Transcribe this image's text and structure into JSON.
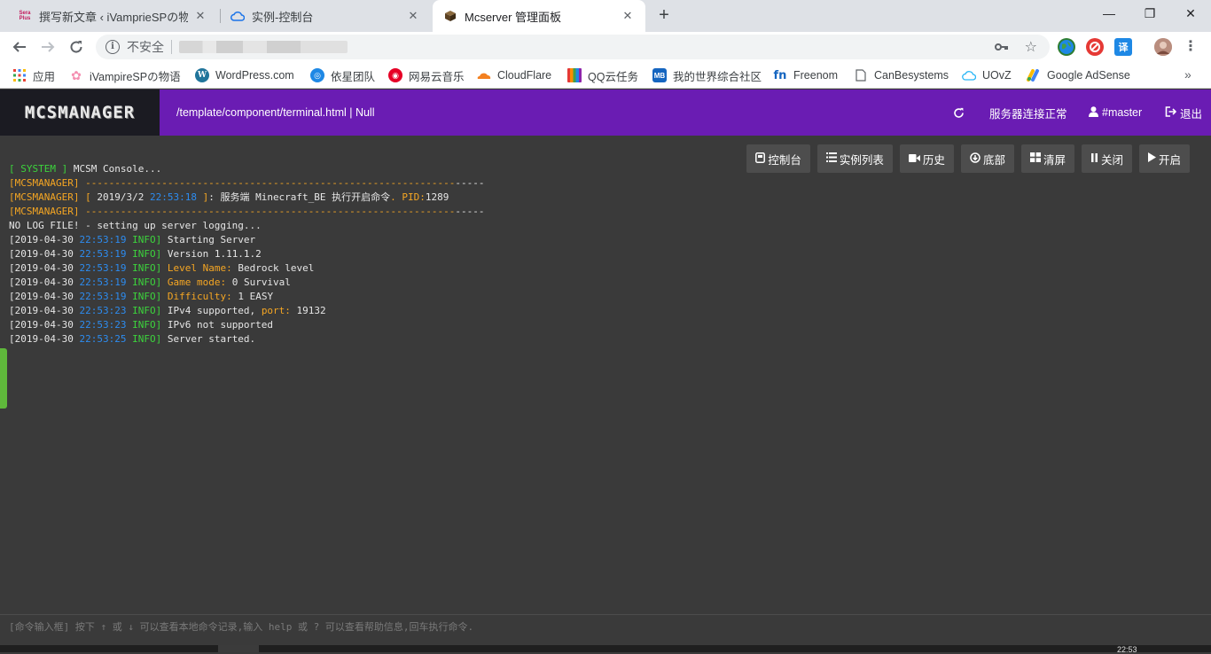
{
  "browser": {
    "tabs": [
      {
        "title": "撰写新文章 ‹ iVamprieSPの物语",
        "icon": "sera-plus-icon",
        "active": false
      },
      {
        "title": "实例-控制台",
        "icon": "cloud-icon",
        "active": false
      },
      {
        "title": "Mcserver 管理面板",
        "icon": "minecraft-block-icon",
        "active": true
      }
    ],
    "new_tab": "+",
    "window_controls": {
      "minimize": "—",
      "maximize": "❐",
      "close": "✕"
    },
    "address": {
      "security_label": "不安全"
    },
    "bookmarks": [
      {
        "label": "应用",
        "icon": "apps-grid-icon"
      },
      {
        "label": "iVampireSPの物语",
        "icon": "flower-icon"
      },
      {
        "label": "WordPress.com",
        "icon": "wordpress-icon"
      },
      {
        "label": "依星团队",
        "icon": "team-icon"
      },
      {
        "label": "网易云音乐",
        "icon": "netease-music-icon"
      },
      {
        "label": "CloudFlare",
        "icon": "cloudflare-icon"
      },
      {
        "label": "QQ云任务",
        "icon": "qq-task-icon"
      },
      {
        "label": "我的世界综合社区",
        "icon": "mb-icon"
      },
      {
        "label": "Freenom",
        "icon": "freenom-icon"
      },
      {
        "label": "CanBesystems",
        "icon": "page-icon"
      },
      {
        "label": "UOvZ",
        "icon": "cloud-outline-icon"
      },
      {
        "label": "Google AdSense",
        "icon": "adsense-icon"
      }
    ],
    "bookmarks_more": "»",
    "sera_icon_text": "Sera Plus",
    "translate_icon_text": "译",
    "mb_icon_text": "MB",
    "fn_icon_text": "fn"
  },
  "app": {
    "logo": "MCSMANAGER",
    "path": "/template/component/terminal.html | Null",
    "status": "服务器连接正常",
    "user": "#master",
    "logout": "退出"
  },
  "console": {
    "buttons": [
      {
        "label": "控制台",
        "icon": "console-icon"
      },
      {
        "label": "实例列表",
        "icon": "list-icon"
      },
      {
        "label": "历史",
        "icon": "video-icon"
      },
      {
        "label": "底部",
        "icon": "download-circle-icon"
      },
      {
        "label": "清屏",
        "icon": "grid-icon"
      },
      {
        "label": "关闭",
        "icon": "pause-icon"
      },
      {
        "label": "开启",
        "icon": "play-icon"
      }
    ],
    "log": [
      [
        {
          "t": "[ SYSTEM ]",
          "c": "g"
        },
        {
          "t": " MCSM Console...",
          "c": "w"
        }
      ],
      [
        {
          "t": "[MCSMANAGER]",
          "c": "o"
        },
        {
          "t": " ---------------------------------------------------------------",
          "c": "o"
        },
        {
          "t": "-----",
          "c": "w"
        }
      ],
      [
        {
          "t": "[MCSMANAGER]",
          "c": "o"
        },
        {
          "t": " [ ",
          "c": "o"
        },
        {
          "t": "2019/3/2 ",
          "c": "w"
        },
        {
          "t": "22:53:18",
          "c": "b"
        },
        {
          "t": " ]",
          "c": "o"
        },
        {
          "t": ": 服务端 Minecraft_BE 执行开启命令",
          "c": "w"
        },
        {
          "t": ". PID:",
          "c": "o"
        },
        {
          "t": "1289",
          "c": "w"
        }
      ],
      [
        {
          "t": "[MCSMANAGER]",
          "c": "o"
        },
        {
          "t": " ---------------------------------------------------------------",
          "c": "o"
        },
        {
          "t": "-----",
          "c": "w"
        }
      ],
      [
        {
          "t": "NO LOG FILE! - setting up server logging...",
          "c": "w"
        }
      ],
      [
        {
          "t": "[2019-04-30 ",
          "c": "w"
        },
        {
          "t": "22:53:19",
          "c": "b"
        },
        {
          "t": " INFO]",
          "c": "g"
        },
        {
          "t": " Starting Server",
          "c": "w"
        }
      ],
      [
        {
          "t": "[2019-04-30 ",
          "c": "w"
        },
        {
          "t": "22:53:19",
          "c": "b"
        },
        {
          "t": " INFO]",
          "c": "g"
        },
        {
          "t": " Version 1.11.1.2",
          "c": "w"
        }
      ],
      [
        {
          "t": "[2019-04-30 ",
          "c": "w"
        },
        {
          "t": "22:53:19",
          "c": "b"
        },
        {
          "t": " INFO]",
          "c": "g"
        },
        {
          "t": " Level Name:",
          "c": "o"
        },
        {
          "t": " Bedrock level",
          "c": "w"
        }
      ],
      [
        {
          "t": "[2019-04-30 ",
          "c": "w"
        },
        {
          "t": "22:53:19",
          "c": "b"
        },
        {
          "t": " INFO]",
          "c": "g"
        },
        {
          "t": " Game mode:",
          "c": "o"
        },
        {
          "t": " 0 Survival",
          "c": "w"
        }
      ],
      [
        {
          "t": "[2019-04-30 ",
          "c": "w"
        },
        {
          "t": "22:53:19",
          "c": "b"
        },
        {
          "t": " INFO]",
          "c": "g"
        },
        {
          "t": " Difficulty:",
          "c": "o"
        },
        {
          "t": " 1 EASY",
          "c": "w"
        }
      ],
      [
        {
          "t": "[2019-04-30 ",
          "c": "w"
        },
        {
          "t": "22:53:23",
          "c": "b"
        },
        {
          "t": " INFO]",
          "c": "g"
        },
        {
          "t": " IPv4 supported, ",
          "c": "w"
        },
        {
          "t": "port:",
          "c": "o"
        },
        {
          "t": " 19132",
          "c": "w"
        }
      ],
      [
        {
          "t": "[2019-04-30 ",
          "c": "w"
        },
        {
          "t": "22:53:23",
          "c": "b"
        },
        {
          "t": " INFO]",
          "c": "g"
        },
        {
          "t": " IPv6 not supported",
          "c": "w"
        }
      ],
      [
        {
          "t": "[2019-04-30 ",
          "c": "w"
        },
        {
          "t": "22:53:25",
          "c": "b"
        },
        {
          "t": " INFO]",
          "c": "g"
        },
        {
          "t": " Server started.",
          "c": "w"
        }
      ]
    ],
    "command_placeholder": "[命令输入框] 按下 ↑ 或 ↓ 可以查看本地命令记录,输入 help 或 ? 可以查看帮助信息,回车执行命令."
  },
  "taskbar": {
    "clock": "22:53"
  },
  "colors": {
    "header": "#6a1cb3",
    "logo_bg": "#1b1b22",
    "console_bg": "#3a3a3a",
    "green": "#3cd43c",
    "orange": "#f5a623",
    "blue": "#2d8cf0"
  }
}
